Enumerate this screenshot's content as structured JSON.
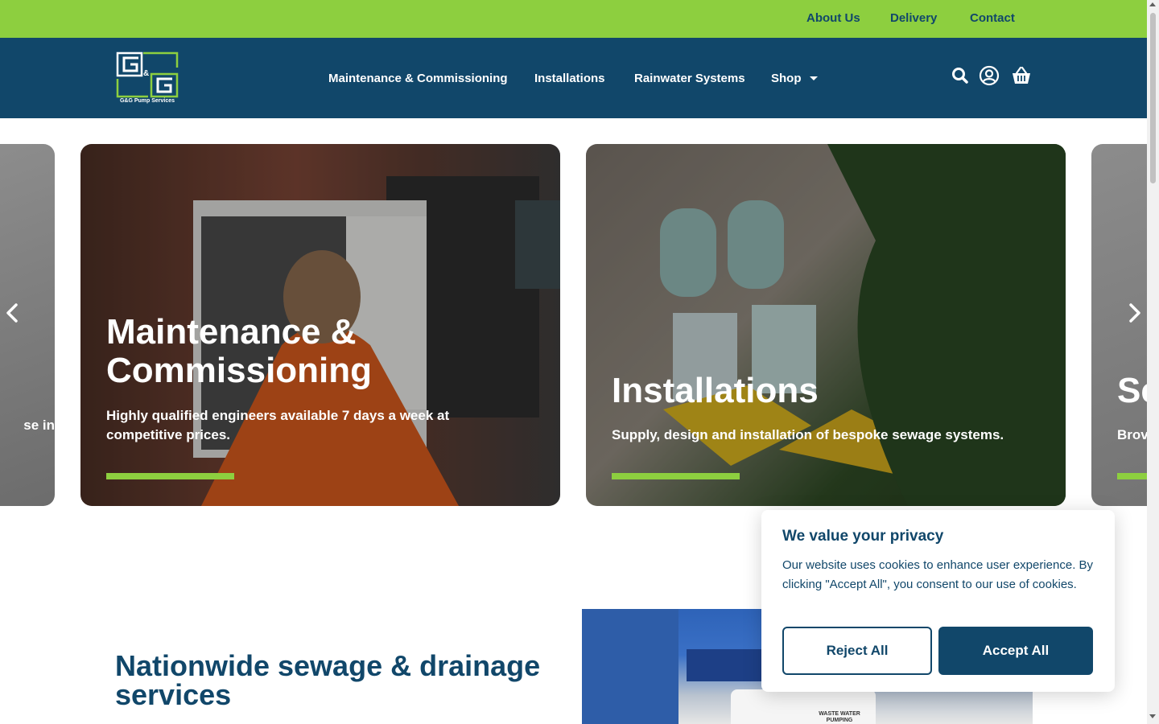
{
  "topbar": {
    "links": [
      "About Us",
      "Delivery",
      "Contact"
    ],
    "color": "#8dcf3f"
  },
  "header": {
    "logo_text": "G&G Pump Services",
    "logo_letters": [
      "G",
      "&",
      "G"
    ],
    "nav": [
      "Maintenance & Commissioning",
      "Installations",
      "Rainwater Systems",
      "Shop"
    ],
    "icons": [
      "search-icon",
      "account-icon",
      "basket-icon"
    ],
    "color": "#11476a"
  },
  "carousel": {
    "left_partial": {
      "text": "se in"
    },
    "cards": [
      {
        "title": "Maintenance & Commissioning",
        "description": "Highly qualified engineers available 7 days a week at competitive prices."
      },
      {
        "title": "Installations",
        "description": "Supply, design and installation of bespoke sewage systems."
      }
    ],
    "right_partial": {
      "title": "Se",
      "text": "Brov"
    },
    "arrows": [
      "chevron-left-icon",
      "chevron-right-icon"
    ]
  },
  "section": {
    "title": "Nationwide sewage & drainage services",
    "van_text": "WASTE WATER PUMPING SYSTEMS"
  },
  "cookie": {
    "title": "We value your privacy",
    "text": "Our website uses cookies to enhance user experience. By clicking \"Accept All\", you consent to our use of cookies.",
    "reject": "Reject All",
    "accept": "Accept All"
  }
}
